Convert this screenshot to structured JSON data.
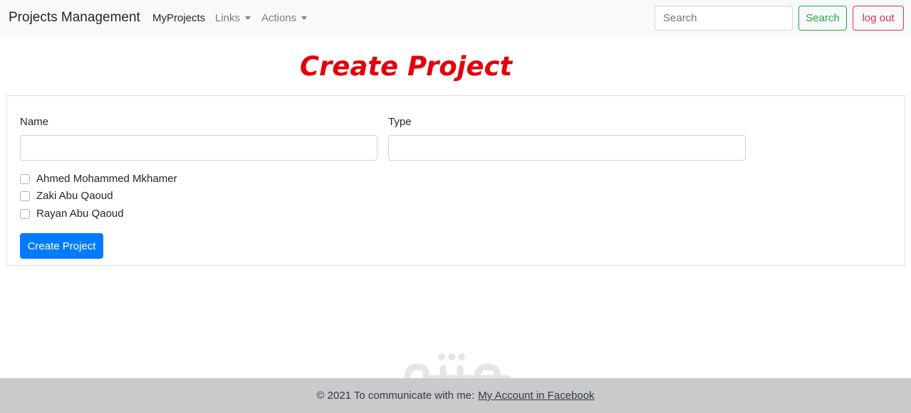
{
  "navbar": {
    "brand": "Projects Management",
    "links": [
      {
        "label": "MyProjects"
      },
      {
        "label": "Links"
      },
      {
        "label": "Actions"
      }
    ],
    "search_placeholder": "Search",
    "search_button": "Search",
    "logout_button": "log out"
  },
  "page": {
    "title": "Create Project"
  },
  "form": {
    "name_label": "Name",
    "name_value": "",
    "type_label": "Type",
    "type_value": "",
    "members": [
      {
        "name": "Ahmed Mohammed Mkhamer",
        "checked": false
      },
      {
        "name": "Zaki Abu Qaoud",
        "checked": false
      },
      {
        "name": "Rayan Abu Qaoud",
        "checked": false
      }
    ],
    "submit_label": "Create Project"
  },
  "footer": {
    "text": "© 2021 To communicate with me:",
    "link": "My Account in Facebook"
  },
  "colors": {
    "title": "#e3000b",
    "primary": "#007bff",
    "success": "#28a745",
    "danger": "#dc3545",
    "footer_bg": "#c9cacc"
  }
}
